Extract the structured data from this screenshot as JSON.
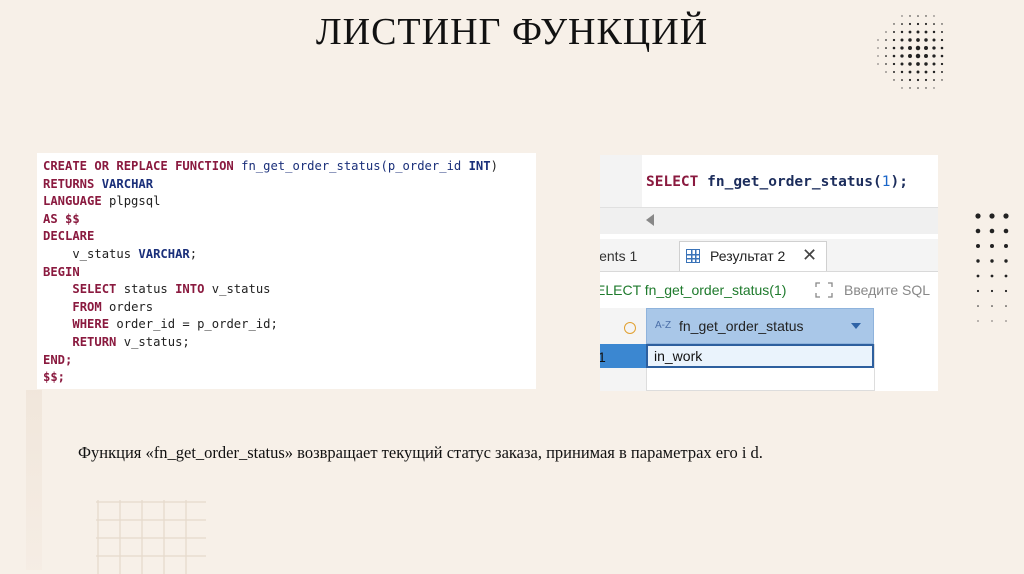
{
  "slide": {
    "title": "ЛИСТИНГ ФУНКЦИЙ",
    "description": "Функция «fn_get_order_status» возвращает текущий статус заказа, принимая в параметрах его i d."
  },
  "code_listing": {
    "lines": [
      "CREATE OR REPLACE FUNCTION fn_get_order_status(p_order_id INT)",
      "RETURNS VARCHAR",
      "LANGUAGE plpgsql",
      "AS $$",
      "DECLARE",
      "    v_status VARCHAR;",
      "BEGIN",
      "    SELECT status INTO v_status",
      "    FROM orders",
      "    WHERE order_id = p_order_id;",
      "    RETURN v_status;",
      "END;",
      "$$;"
    ]
  },
  "dbeaver": {
    "editor_query": {
      "keyword": "SELECT",
      "function": "fn_get_order_status(",
      "arg": "1",
      "tail": ");"
    },
    "tabs": [
      {
        "label": "ients 1"
      },
      {
        "label": "Результат 2",
        "active": true,
        "close": "✕"
      }
    ],
    "query_bar": {
      "query_text": "ELECT fn_get_order_status(1)",
      "filter_placeholder": "Введите SQL"
    },
    "grid": {
      "column_type_badge": "A-Z",
      "column_name": "fn_get_order_status",
      "row_number": "1",
      "cell_value": "in_work"
    }
  },
  "colors": {
    "background": "#f7f0e8",
    "keyword": "#8a1a3f",
    "identifier": "#1a2f7a",
    "selected_header": "#a9c7e8",
    "row_selected": "#3b87d1"
  }
}
